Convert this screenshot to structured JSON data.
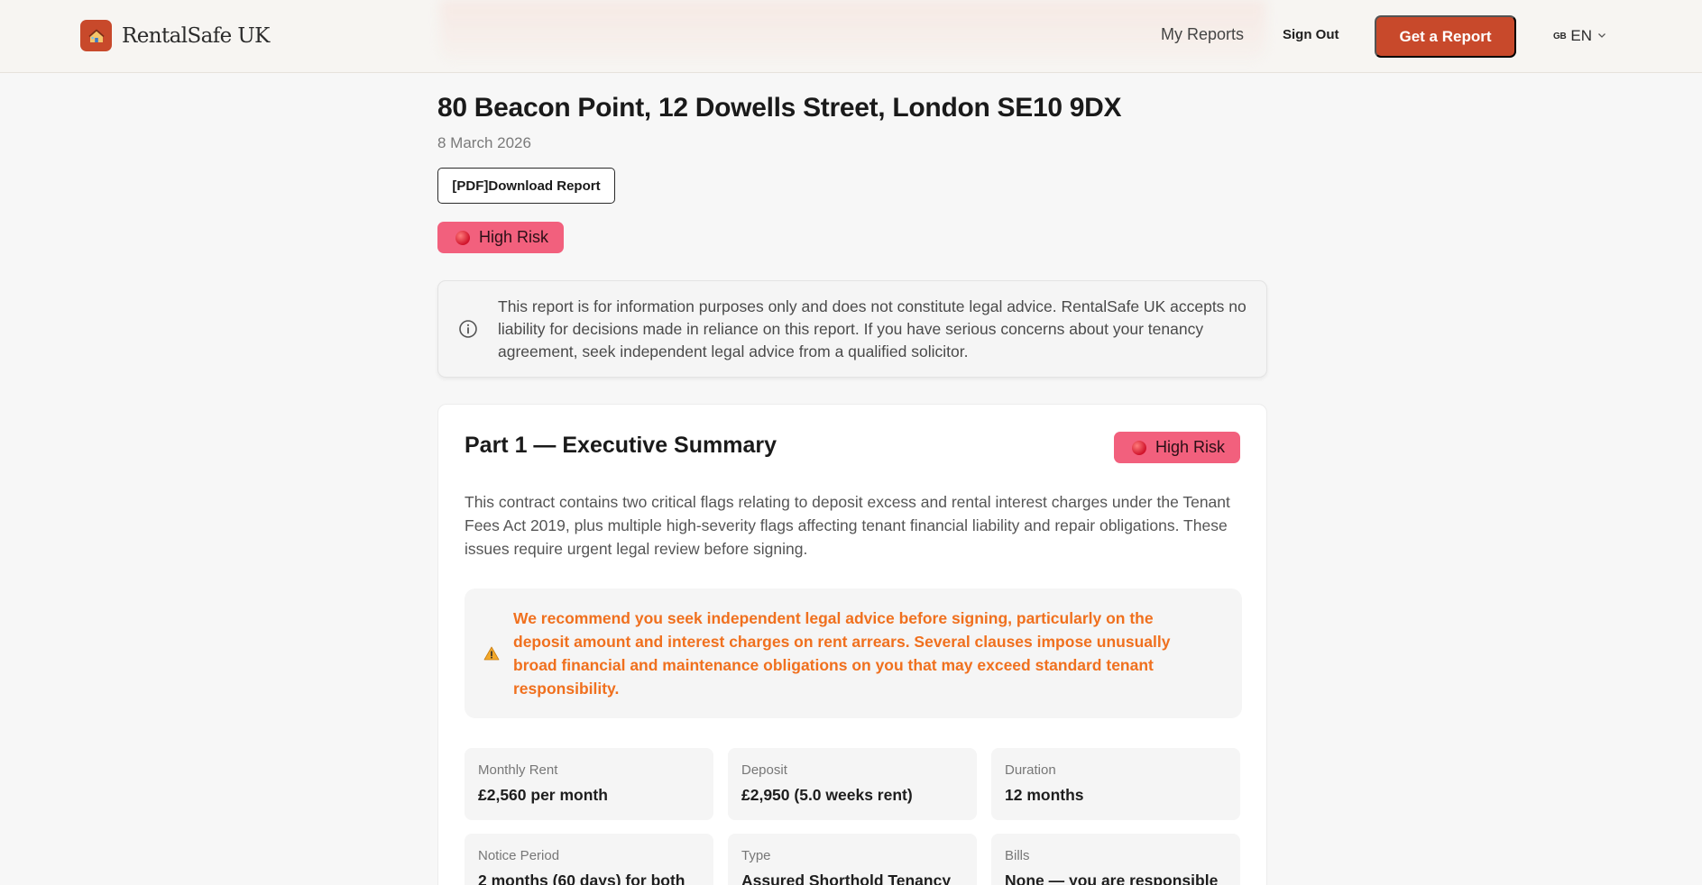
{
  "header": {
    "brand": "RentalSafe UK",
    "nav_reports": "My Reports",
    "nav_signout": "Sign Out",
    "cta": "Get a Report",
    "lang_flag": "GB",
    "lang_code": "EN"
  },
  "report": {
    "address": "80 Beacon Point, 12 Dowells Street, London SE10 9DX",
    "date": "8 March 2026",
    "download_label": "[PDF]Download Report",
    "risk_label": "High Risk",
    "disclaimer": "This report is for information purposes only and does not constitute legal advice. RentalSafe UK accepts no liability for decisions made in reliance on this report. If you have serious concerns about your tenancy agreement, seek independent legal advice from a qualified solicitor."
  },
  "summary_card": {
    "title": "Part 1 — Executive Summary",
    "risk_label": "High Risk",
    "text": "This contract contains two critical flags relating to deposit excess and rental interest charges under the Tenant Fees Act 2019, plus multiple high-severity flags affecting tenant financial liability and repair obligations. These issues require urgent legal review before signing.",
    "warning": "We recommend you seek independent legal advice before signing, particularly on the deposit amount and interest charges on rent arrears. Several clauses impose unusually broad financial and maintenance obligations on you that may exceed standard tenant responsibility.",
    "facts": [
      {
        "label": "Monthly Rent",
        "value": "£2,560 per month"
      },
      {
        "label": "Deposit",
        "value": "£2,950 (5.0 weeks rent)"
      },
      {
        "label": "Duration",
        "value": "12 months"
      },
      {
        "label": "Notice Period",
        "value": "2 months (60 days) for both"
      },
      {
        "label": "Type",
        "value": "Assured Shorthold Tenancy"
      },
      {
        "label": "Bills",
        "value": "None — you are responsible"
      }
    ]
  },
  "colors": {
    "brand": "#c8492b",
    "risk_high": "#f2607d",
    "warning_text": "#f0701e"
  },
  "icons": [
    "house-logo-icon",
    "chevron-down-icon",
    "info-icon",
    "warning-icon",
    "risk-dot-icon"
  ]
}
